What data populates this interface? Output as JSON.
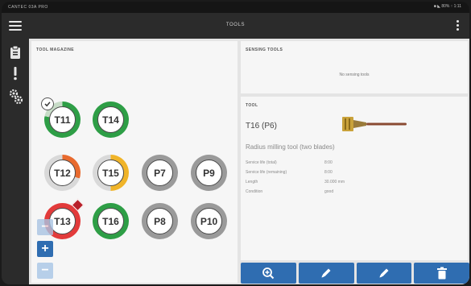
{
  "status_bar": {
    "left_text": "CANTEC 03A PRO",
    "right_text": "■ ◣ 80% ↑ 1:11"
  },
  "app_bar": {
    "title": "TOOLS"
  },
  "magazine": {
    "title": "TOOL MAGAZINE",
    "slots": [
      {
        "label": "T11",
        "status": "good",
        "selected": true
      },
      {
        "label": "T14",
        "status": "good"
      },
      {
        "label": "T12",
        "status": "low"
      },
      {
        "label": "T15",
        "status": "warn"
      },
      {
        "label": "P7",
        "status": "empty"
      },
      {
        "label": "P9",
        "status": "empty"
      },
      {
        "label": "T13",
        "status": "critical",
        "alert": true
      },
      {
        "label": "T16",
        "status": "good"
      },
      {
        "label": "P8",
        "status": "empty"
      },
      {
        "label": "P10",
        "status": "empty"
      }
    ],
    "controls": [
      "minus",
      "plus",
      "minus"
    ]
  },
  "sensing": {
    "title": "SENSING TOOLS",
    "empty_text": "No sensing tools"
  },
  "tool_detail": {
    "title": "TOOL",
    "name": "T16 (P6)",
    "description": "Radius milling tool (two blades)",
    "properties": [
      {
        "label": "Service life (total)",
        "value": "8:00"
      },
      {
        "label": "Service life (remaining)",
        "value": "8:00"
      },
      {
        "label": "Length",
        "value": "30.000 mm"
      },
      {
        "label": "Condition",
        "value": "good"
      }
    ]
  },
  "actions": [
    "zoom-in-icon",
    "edit-icon",
    "edit-icon",
    "delete-icon"
  ],
  "colors": {
    "accent": "#2f6db1",
    "good": "#2e9e46",
    "warn": "#f0b429",
    "low": "#e86a2e",
    "critical": "#e23b3b",
    "empty": "#9a9a9a"
  }
}
